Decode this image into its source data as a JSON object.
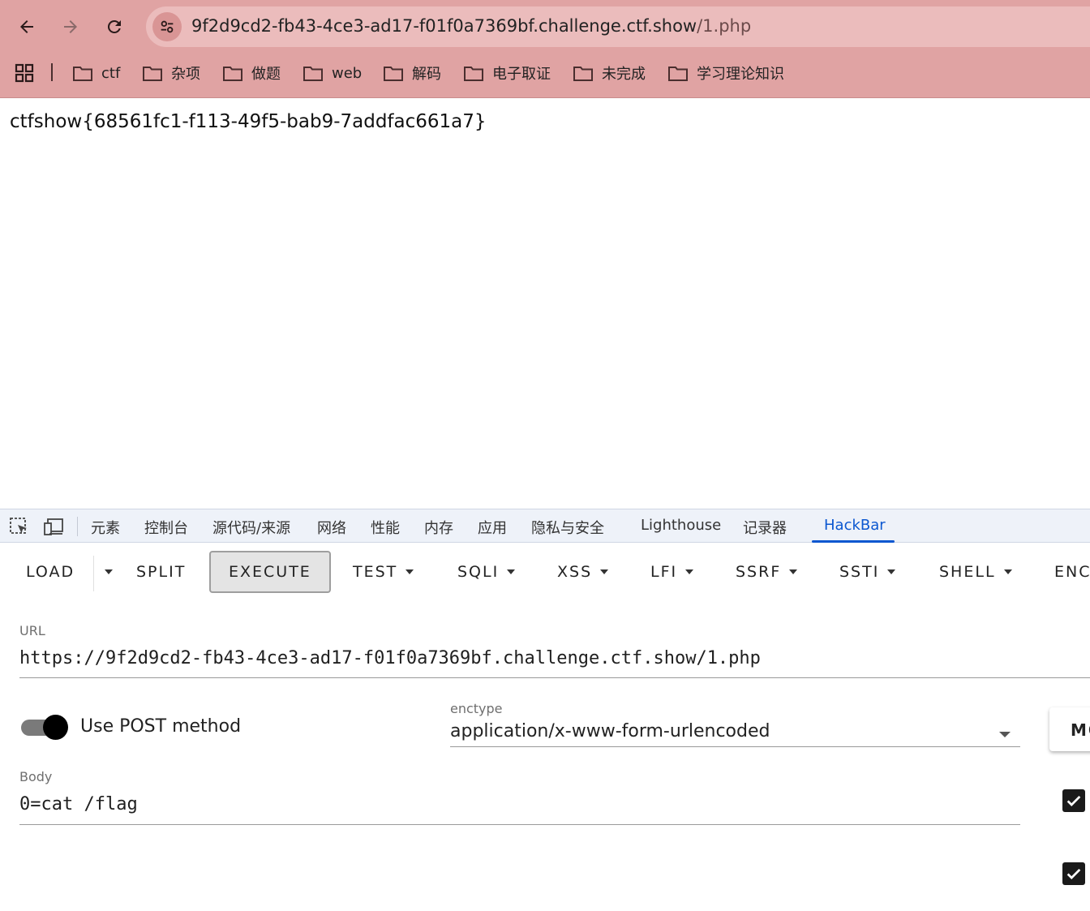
{
  "browser": {
    "url_host": "9f2d9cd2-fb43-4ce3-ad17-f01f0a7369bf.challenge.ctf.show",
    "url_path": "/1.php",
    "bookmarks": [
      "ctf",
      "杂项",
      "做题",
      "web",
      "解码",
      "电子取证",
      "未完成",
      "学习理论知识"
    ]
  },
  "page": {
    "body_text": "ctfshow{68561fc1-f113-49f5-bab9-7addfac661a7}"
  },
  "devtools": {
    "tabs": [
      "元素",
      "控制台",
      "源代码/来源",
      "网络",
      "性能",
      "内存",
      "应用",
      "隐私与安全",
      "Lighthouse",
      "记录器",
      "HackBar"
    ],
    "active_tab": "HackBar"
  },
  "hackbar": {
    "toolbar": {
      "load": "LOAD",
      "split": "SPLIT",
      "execute": "EXECUTE",
      "test": "TEST",
      "sqli": "SQLI",
      "xss": "XSS",
      "lfi": "LFI",
      "ssrf": "SSRF",
      "ssti": "SSTI",
      "shell": "SHELL",
      "enc": "ENC"
    },
    "url_label": "URL",
    "url_value": "https://9f2d9cd2-fb43-4ce3-ad17-f01f0a7369bf.challenge.ctf.show/1.php",
    "post_toggle_label": "Use POST method",
    "post_enabled": true,
    "enctype_label": "enctype",
    "enctype_value": "application/x-www-form-urlencoded",
    "mode_button": "MO",
    "body_label": "Body",
    "body_value": "0=cat /flag",
    "checkboxes": [
      true,
      true
    ]
  }
}
